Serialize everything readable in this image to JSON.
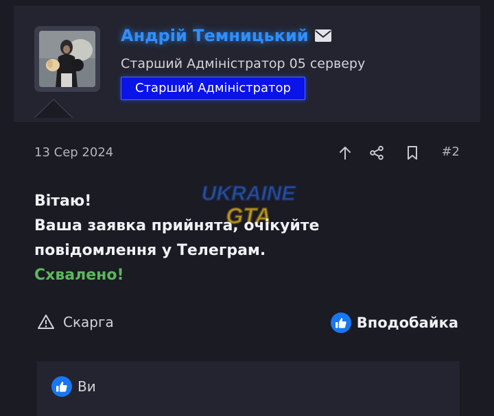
{
  "user": {
    "name": "Андрій Темницький",
    "title": "Старший Адміністратор 05 серверу",
    "role_badge": "Старший Адміністратор"
  },
  "post": {
    "date": "13 Сер 2024",
    "number": "#2",
    "lines": [
      "Вітаю!",
      "Ваша заявка прийнята, очікуйте",
      "повідомлення у Телеграм."
    ],
    "status": "Схвалено!"
  },
  "watermark": {
    "line1": "UKRAINE",
    "line2": "GTA"
  },
  "actions": {
    "report_label": "Скарга",
    "like_label": "Вподобайка"
  },
  "reactions": {
    "by": "Ви"
  },
  "colors": {
    "accent": "#2f8fff",
    "badge": "#0a13e8",
    "approved": "#5cb85c",
    "like": "#1877f2"
  },
  "icons": [
    "mail-icon",
    "arrow-up-icon",
    "share-icon",
    "bookmark-icon",
    "warning-icon",
    "thumbs-up-icon"
  ]
}
